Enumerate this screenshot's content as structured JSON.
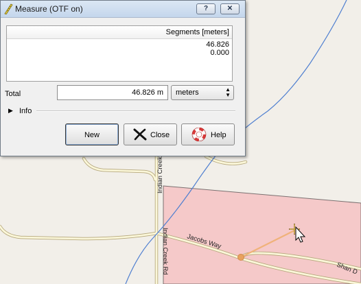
{
  "dialog": {
    "title": "Measure (OTF on)",
    "help_glyph": "?",
    "close_glyph": "✕",
    "segments_header": "Segments [meters]",
    "segments": [
      "46.826",
      "0.000"
    ],
    "total_label": "Total",
    "total_value": "46.826 m",
    "units_value": "meters",
    "info_label": "Info",
    "buttons": {
      "new": "New",
      "close": "Close",
      "help": "Help"
    }
  },
  "map": {
    "labels": {
      "indian_creek_upper": "Indian Creek",
      "indian_creek_rd": "Indian Creek Rd",
      "jacobs_way": "Jacobs Way",
      "shan_d": "Shan D"
    }
  }
}
